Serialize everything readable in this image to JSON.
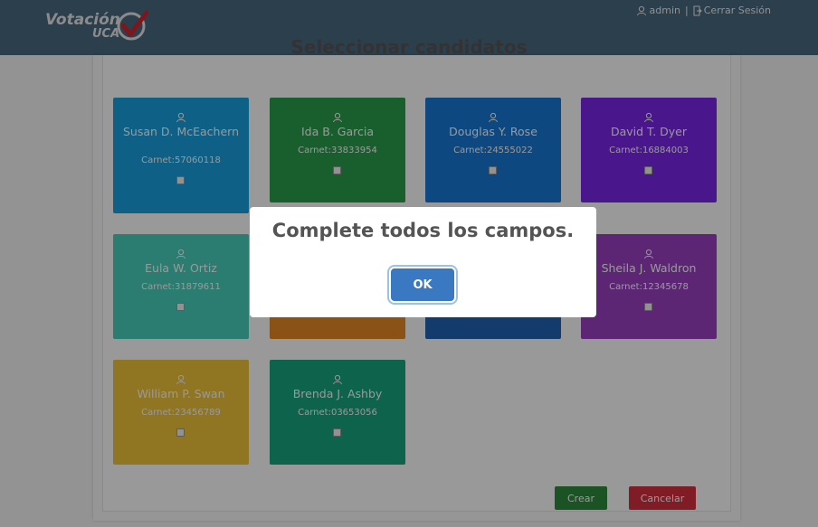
{
  "brand": {
    "line1": "Votación",
    "line2": "UCA"
  },
  "header": {
    "user_name": "admin",
    "separator": "|",
    "logout_label": "Cerrar Sesión"
  },
  "page": {
    "heading": "Seleccionar candidatos"
  },
  "candidates": [
    {
      "name": "Susan D. McEachern",
      "carnet": "Carnet:57060118",
      "color": "#18a0e0",
      "selected": false
    },
    {
      "name": "Ida B. Garcia",
      "carnet": "Carnet:33833954",
      "color": "#2a9f4e",
      "selected": false
    },
    {
      "name": "Douglas Y. Rose",
      "carnet": "Carnet:24555022",
      "color": "#1778d8",
      "selected": false
    },
    {
      "name": "David T. Dyer",
      "carnet": "Carnet:16884003",
      "color": "#7a25e8",
      "selected": false
    },
    {
      "name": "Eula W. Ortiz",
      "carnet": "Carnet:31879611",
      "color": "#48cfbd",
      "selected": false
    },
    {
      "name": "",
      "carnet": "",
      "color": "#e68a23",
      "selected": false
    },
    {
      "name": "",
      "carnet": "",
      "color": "#2065b5",
      "selected": false
    },
    {
      "name": "Sheila J. Waldron",
      "carnet": "Carnet:12345678",
      "color": "#9a40c4",
      "selected": false
    },
    {
      "name": "William P. Swan",
      "carnet": "Carnet:23456789",
      "color": "#f0c43a",
      "selected": false
    },
    {
      "name": "Brenda J. Ashby",
      "carnet": "Carnet:03653056",
      "color": "#17a67e",
      "selected": false
    }
  ],
  "actions": {
    "create_label": "Crear",
    "cancel_label": "Cancelar"
  },
  "modal": {
    "message": "Complete todos los campos.",
    "ok_label": "OK"
  }
}
